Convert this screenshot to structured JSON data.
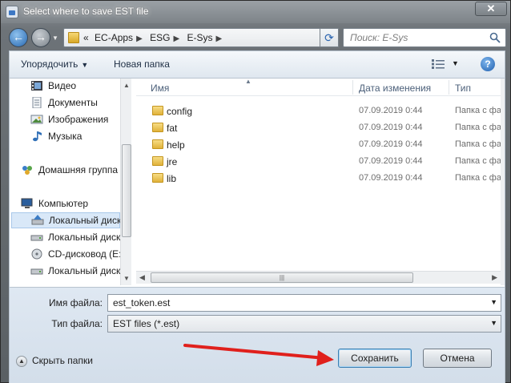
{
  "window": {
    "title": "Select where to save EST file",
    "close_label": "✕"
  },
  "address": {
    "prefix": "«",
    "crumbs": [
      "EC-Apps",
      "ESG",
      "E-Sys"
    ]
  },
  "search": {
    "placeholder": "Поиск: E-Sys"
  },
  "toolbar": {
    "organize_label": "Упорядочить",
    "new_folder_label": "Новая папка"
  },
  "nav": {
    "items": [
      {
        "label": "Видео",
        "icon": "video-library-icon"
      },
      {
        "label": "Документы",
        "icon": "documents-library-icon"
      },
      {
        "label": "Изображения",
        "icon": "pictures-library-icon"
      },
      {
        "label": "Музыка",
        "icon": "music-library-icon"
      },
      {
        "label": "Домашняя группа",
        "icon": "homegroup-icon"
      },
      {
        "label": "Компьютер",
        "icon": "computer-icon"
      },
      {
        "label": "Локальный диск",
        "icon": "local-disk-icon"
      },
      {
        "label": "Локальный диск",
        "icon": "local-disk-icon"
      },
      {
        "label": "CD-дисковод (E:",
        "icon": "cd-drive-icon"
      },
      {
        "label": "Локальный диск",
        "icon": "local-disk-icon"
      }
    ]
  },
  "files": {
    "columns": [
      "Имя",
      "Дата изменения",
      "Тип"
    ],
    "rows": [
      {
        "name": "config",
        "date": "07.09.2019 0:44",
        "type": "Папка с файл"
      },
      {
        "name": "fat",
        "date": "07.09.2019 0:44",
        "type": "Папка с файл"
      },
      {
        "name": "help",
        "date": "07.09.2019 0:44",
        "type": "Папка с файл"
      },
      {
        "name": "jre",
        "date": "07.09.2019 0:44",
        "type": "Папка с файл"
      },
      {
        "name": "lib",
        "date": "07.09.2019 0:44",
        "type": "Папка с файл"
      }
    ]
  },
  "form": {
    "filename_label": "Имя файла:",
    "filename_value": "est_token.est",
    "filetype_label": "Тип файла:",
    "filetype_value": "EST files (*.est)",
    "hide_folders_label": "Скрыть папки",
    "save_label": "Сохранить",
    "cancel_label": "Отмена"
  },
  "colors": {
    "annotation_arrow": "#e0201c",
    "folder": "#e0b23a",
    "selection": "#d9e8f8"
  }
}
